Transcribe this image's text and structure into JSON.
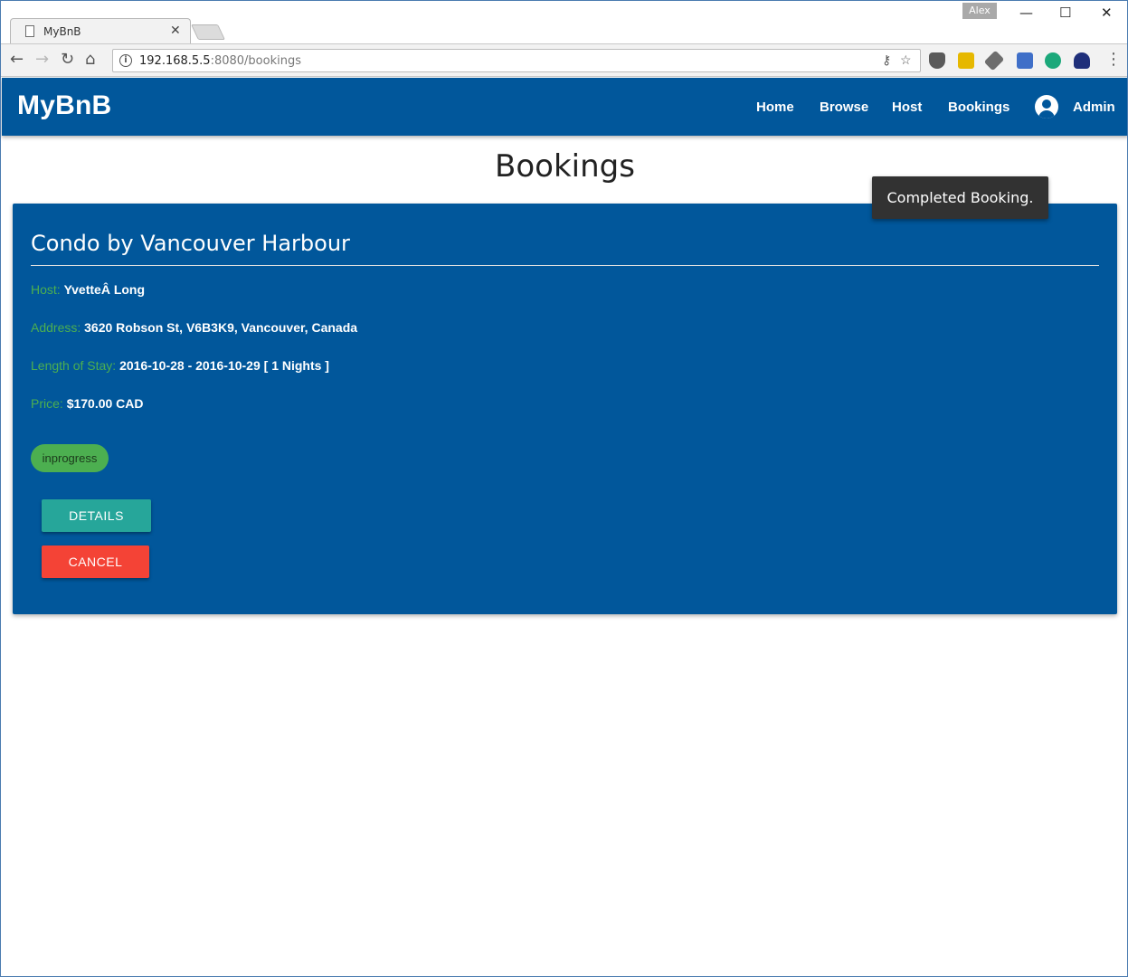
{
  "browser": {
    "tab_title": "MyBnB",
    "tab_close": "✕",
    "profile_name": "Alex",
    "minimize": "—",
    "maximize": "☐",
    "close": "✕",
    "back": "←",
    "forward": "→",
    "reload": "↻",
    "home": "⌂",
    "info": "i",
    "url_host": "192.168.5.5",
    "url_rest": ":8080/bookings",
    "key_icon": "⚷",
    "star_icon": "☆",
    "menu_icon": "⋮",
    "extensions": [
      "shield-extension",
      "lock-extension",
      "dropper-extension",
      "calendar-extension",
      "green-extension",
      "wifi-extension"
    ]
  },
  "appbar": {
    "brand": "MyBnB",
    "nav": [
      "Home",
      "Browse",
      "Host",
      "Bookings"
    ],
    "account_label": "Admin"
  },
  "page": {
    "title": "Bookings"
  },
  "booking": {
    "title": "Condo by Vancouver Harbour",
    "host_label": "Host:",
    "host_value": "YvetteÂ Long",
    "address_label": "Address:",
    "address_value": "3620 Robson St, V6B3K9, Vancouver, Canada",
    "stay_label": "Length of Stay:",
    "stay_value": "2016-10-28 - 2016-10-29 [ 1 Nights ]",
    "price_label": "Price:",
    "price_value": "$170.00 CAD",
    "status": "inprogress",
    "details_button": "DETAILS",
    "cancel_button": "CANCEL"
  },
  "toast": {
    "message": "Completed Booking."
  },
  "colors": {
    "primary": "#01579b",
    "label_green": "#4caf50",
    "details_teal": "#26a69a",
    "cancel_red": "#f44336",
    "toast_bg": "#323232"
  }
}
